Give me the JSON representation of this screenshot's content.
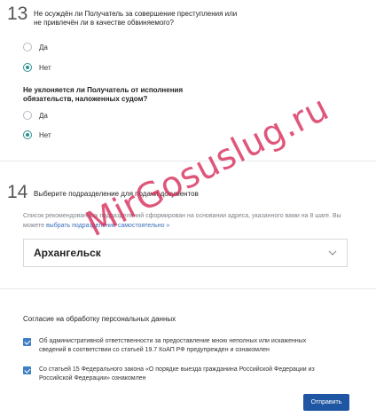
{
  "step13": {
    "number": "13",
    "question1": "Не осуждён ли Получатель за совершение преступления или не привлечён ли в качестве обвиняемого?",
    "q1_options": [
      {
        "label": "Да",
        "checked": false
      },
      {
        "label": "Нет",
        "checked": true
      }
    ],
    "question2": "Не уклоняется ли Получатель от исполнения обязательств, наложенных судом?",
    "q2_options": [
      {
        "label": "Да",
        "checked": false
      },
      {
        "label": "Нет",
        "checked": true
      }
    ]
  },
  "step14": {
    "number": "14",
    "title": "Выберите подразделение для подачи документов",
    "hint_text": "Список рекомендованных подразделений сформирован на основании адреса, указанного вами на 8 шаге. Вы можете",
    "hint_link": "выбрать подразделение самостоятельно",
    "hint_arrow": "»",
    "selected_office": "Архангельск",
    "chevron_icon": "chevron-down-icon"
  },
  "consent": {
    "title": "Согласие на обработку персональных данных",
    "items": [
      {
        "text": "Об административной ответственности за предоставление мною неполных или искаженных сведений в соответствии со статьей 19.7 КоАП РФ предупрежден и ознакомлен",
        "checked": true
      },
      {
        "text": "Со статьей 15 Федерального закона «О порядке выезда гражданина Российской Федерации из Российской Федерации» ознакомлен",
        "checked": true
      }
    ],
    "submit_label": "Отправить"
  },
  "watermark": "MirGosuslug.ru",
  "colors": {
    "accent": "#2d8f8f",
    "checkbox": "#3f7fc4",
    "button": "#1f56a3",
    "link": "#3a6fb8",
    "watermark": "#d62654"
  }
}
